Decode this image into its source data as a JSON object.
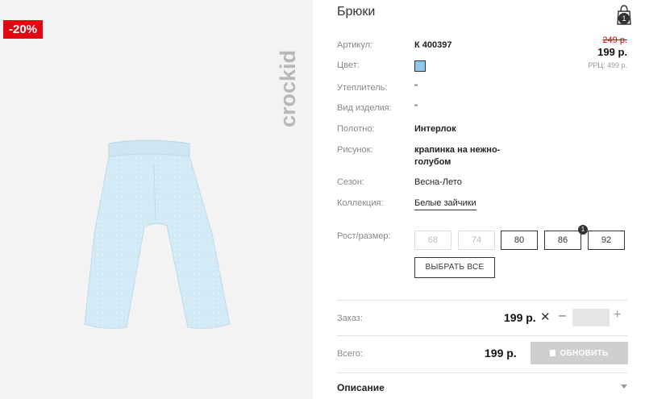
{
  "badge": {
    "discount": "-20%"
  },
  "brand": {
    "logo_text": "crockid"
  },
  "product": {
    "title": "Брюки",
    "image_color": "#cfe8f4"
  },
  "cart": {
    "count": "1"
  },
  "attributes": {
    "article_label": "Артикул:",
    "article_value": "К 400397",
    "color_label": "Цвет:",
    "color_swatch": "#8ec8ef",
    "insulation_label": "Утеплитель:",
    "insulation_value": "\"",
    "type_label": "Вид изделия:",
    "type_value": "\"",
    "fabric_label": "Полотно:",
    "fabric_value": "Интерлок",
    "pattern_label": "Рисунок:",
    "pattern_value_line1": "крапинка на нежно-",
    "pattern_value_line2": "голубом",
    "season_label": "Сезон:",
    "season_value": "Весна-Лето",
    "collection_label": "Коллекция:",
    "collection_value": "Белые зайчики"
  },
  "price": {
    "old": "249 р.",
    "new": "199 р.",
    "rrp": "РРЦ: 499 р."
  },
  "sizes": {
    "label": "Рост/размер:",
    "options": [
      {
        "label": "68",
        "available": false
      },
      {
        "label": "74",
        "available": false
      },
      {
        "label": "80",
        "available": true
      },
      {
        "label": "86",
        "available": true,
        "qty": "1"
      },
      {
        "label": "92",
        "available": true
      }
    ],
    "select_all": "ВЫБРАТЬ ВСЕ"
  },
  "order": {
    "label": "Заказ:",
    "price": "199 р.",
    "quantity": "",
    "minus": "–",
    "plus": "+",
    "remove": "✕"
  },
  "total": {
    "label": "Всего:",
    "price": "199 р.",
    "update_button": "ОБНОВИТЬ"
  },
  "description": {
    "title": "Описание"
  },
  "colors": {
    "badge": "#e30613",
    "button_disabled": "#cfcfcf",
    "qty_bg": "#e6e6e6"
  }
}
